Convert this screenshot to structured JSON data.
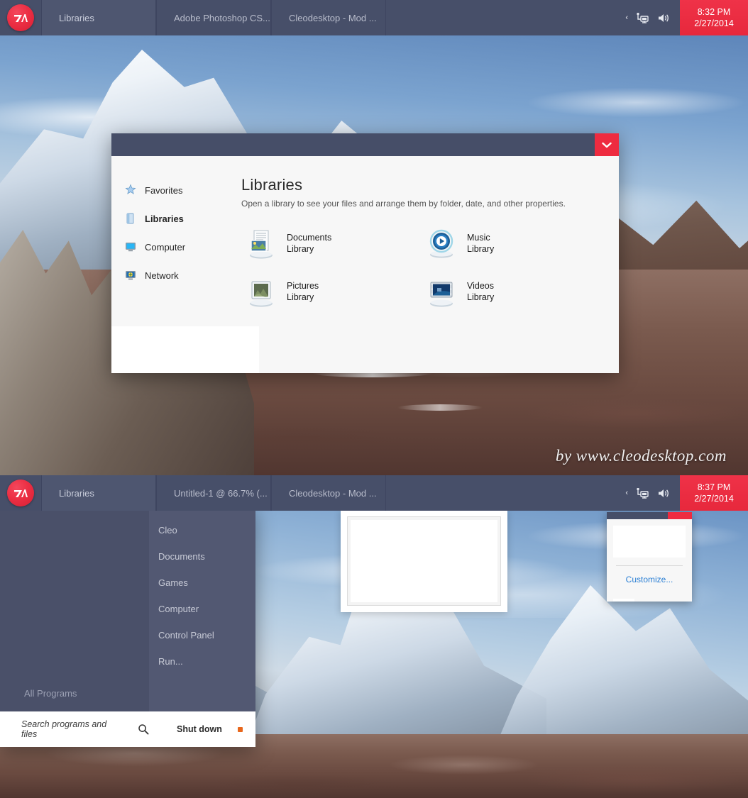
{
  "desktop": {
    "watermark": "by www.cleodesktop.com"
  },
  "taskbar_top": {
    "start_button": {
      "name": "start-orb",
      "icon": "windows-start-icon"
    },
    "buttons": [
      {
        "label": "Libraries",
        "active": true
      },
      {
        "label": "Adobe Photoshop CS...",
        "active": false
      },
      {
        "label": "Cleodesktop - Mod ...",
        "active": false
      }
    ],
    "tray": {
      "chevron": "‹",
      "icons": [
        "network-icon",
        "volume-icon"
      ]
    },
    "clock": {
      "time": "8:32 PM",
      "date": "2/27/2014"
    }
  },
  "taskbar_bottom": {
    "start_button": {
      "name": "start-orb",
      "icon": "windows-start-icon"
    },
    "buttons": [
      {
        "label": "Libraries",
        "active": true
      },
      {
        "label": "Untitled-1 @ 66.7% (...",
        "active": false
      },
      {
        "label": "Cleodesktop - Mod ...",
        "active": false
      }
    ],
    "tray": {
      "chevron": "‹",
      "icons": [
        "network-icon",
        "volume-icon"
      ]
    },
    "clock": {
      "time": "8:37 PM",
      "date": "2/27/2014"
    }
  },
  "libraries_window": {
    "close_glyph": "⌄",
    "sidebar": [
      {
        "label": "Favorites",
        "icon": "favorites-star-icon",
        "selected": false
      },
      {
        "label": "Libraries",
        "icon": "libraries-icon",
        "selected": true
      },
      {
        "label": "Computer",
        "icon": "computer-icon",
        "selected": false
      },
      {
        "label": "Network",
        "icon": "network-globe-icon",
        "selected": false
      }
    ],
    "heading": "Libraries",
    "subheading": "Open a library to see your files and arrange them by folder, date, and other properties.",
    "items": [
      {
        "name": "Documents",
        "sub": "Library",
        "icon": "documents-library-icon"
      },
      {
        "name": "Music",
        "sub": "Library",
        "icon": "music-library-icon"
      },
      {
        "name": "Pictures",
        "sub": "Library",
        "icon": "pictures-library-icon"
      },
      {
        "name": "Videos",
        "sub": "Library",
        "icon": "videos-library-icon"
      }
    ]
  },
  "start_menu": {
    "right_items": [
      {
        "label": "Cleo"
      },
      {
        "label": "Documents"
      },
      {
        "label": "Games"
      },
      {
        "label": "Computer"
      },
      {
        "label": "Control Panel"
      },
      {
        "label": "Run..."
      }
    ],
    "all_programs": "All Programs",
    "search_placeholder": "Search programs and files",
    "search_icon": "search-icon",
    "shutdown_label": "Shut down"
  },
  "customize_popup": {
    "link": "Customize..."
  },
  "colors": {
    "taskbar": "#474f69",
    "taskbar_active": "#4e5670",
    "clock_red": "#ee2b40",
    "accent_red": "#e7283c",
    "window_titlebar": "#464e68",
    "start_left": "#4a5069",
    "start_right": "#525872",
    "link_blue": "#2a7fd4",
    "shutdown_dot": "#e8671c"
  }
}
